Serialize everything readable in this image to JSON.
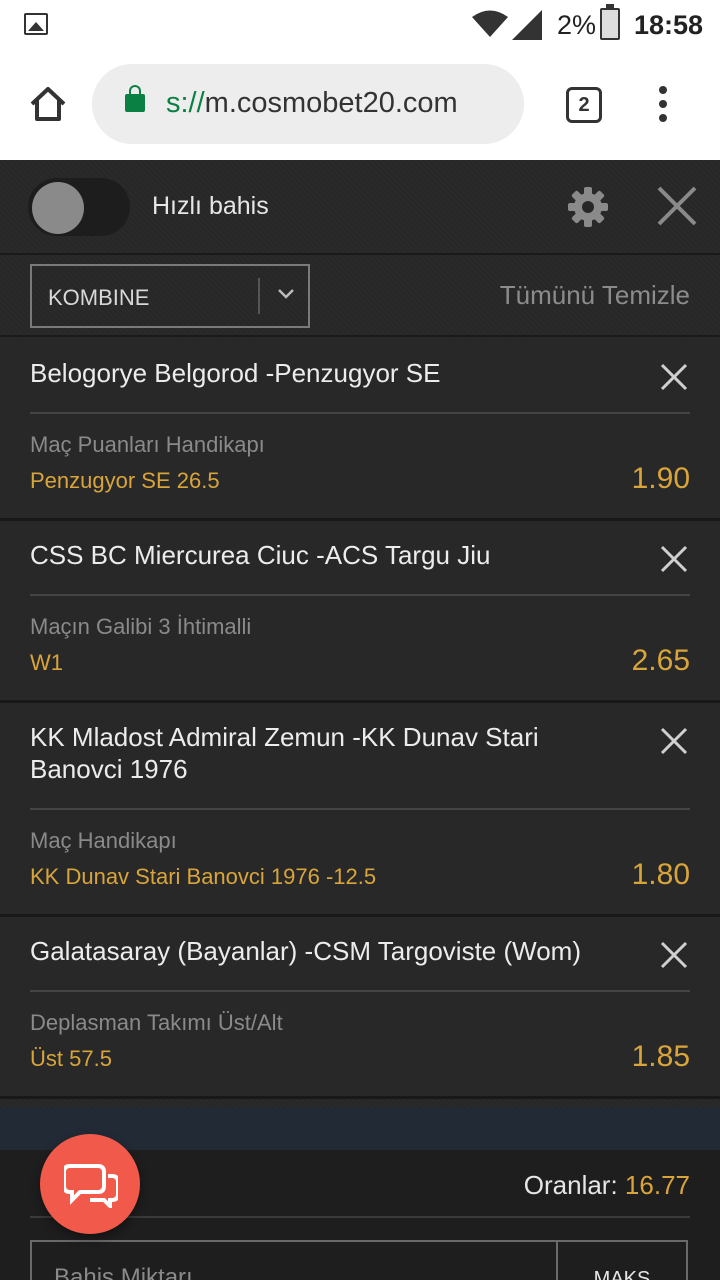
{
  "status_bar": {
    "battery_percent": "2%",
    "time": "18:58"
  },
  "browser": {
    "url_scheme": "s://",
    "url_host": "m.cosmobet20.com",
    "tab_count": "2"
  },
  "betslip": {
    "quick_bet_label": "Hızlı bahis",
    "bet_type": "KOMBINE",
    "clear_all": "Tümünü Temizle",
    "bets": [
      {
        "teams": "Belogorye Belgorod -Penzugyor SE",
        "market": "Maç Puanları Handikapı",
        "selection": "Penzugyor SE 26.5",
        "odds": "1.90"
      },
      {
        "teams": "CSS BC Miercurea Ciuc -ACS Targu Jiu",
        "market": "Maçın Galibi 3 İhtimalli",
        "selection": "W1",
        "odds": "2.65"
      },
      {
        "teams": "KK Mladost Admiral Zemun -KK Dunav Stari Banovci 1976",
        "market": "Maç Handikapı",
        "selection": "KK Dunav Stari Banovci 1976 -12.5",
        "odds": "1.80"
      },
      {
        "teams": "Galatasaray (Bayanlar) -CSM Targoviste (Wom)",
        "market": "Deplasman Takımı Üst/Alt",
        "selection": "Üst 57.5",
        "odds": "1.85"
      }
    ],
    "total_odds_label": "Oranlar:",
    "total_odds": "16.77",
    "stake_placeholder": "Bahis Miktarı",
    "max_label": "MAKS"
  },
  "colors": {
    "accent": "#d9a53a",
    "chat_button": "#f15a4a",
    "secure_green": "#0b8043"
  }
}
